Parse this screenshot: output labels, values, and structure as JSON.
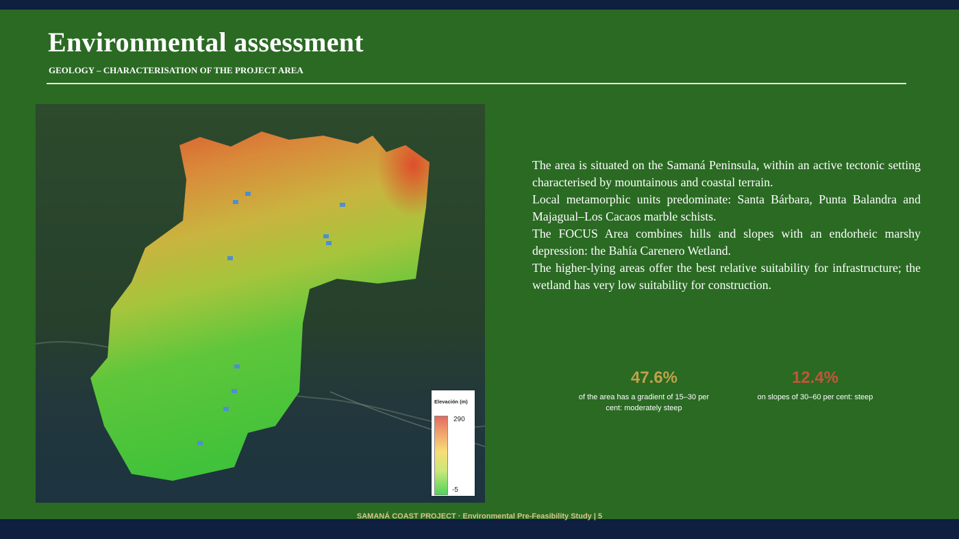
{
  "slide": {
    "title": "Environmental assessment",
    "subtitle": "GEOLOGY – CHARACTERISATION OF THE PROJECT AREA"
  },
  "map": {
    "legend": {
      "title": "Elevación (m)",
      "max": "290",
      "min": "-5"
    }
  },
  "content": {
    "paragraphs": [
      "The area is situated on the Samaná Peninsula, within an active tectonic setting characterised by mountainous and coastal terrain.",
      "Local metamorphic units predominate: Santa Bárbara, Punta Balandra and Majagual–Los Cacaos marble schists.",
      "The FOCUS Area combines hills and slopes with an endorheic marshy depression: the Bahía Carenero Wetland.",
      "The higher-lying areas offer the best relative suitability for infrastructure; the wetland has very low suitability for construction."
    ]
  },
  "stats": [
    {
      "value": "47.6%",
      "description": "of the area has a gradient of 15–30 per cent: moderately steep",
      "color": "#c0a24a"
    },
    {
      "value": "12.4%",
      "description": "on slopes of 30–60 per cent: steep",
      "color": "#c2563a"
    }
  ],
  "footer": {
    "text": "SAMANÁ COAST PROJECT · Environmental Pre-Feasibility Study | 5"
  },
  "colors": {
    "background": "#2a6a23",
    "band": "#0e1f3f",
    "footer_text": "#d7c68c"
  }
}
